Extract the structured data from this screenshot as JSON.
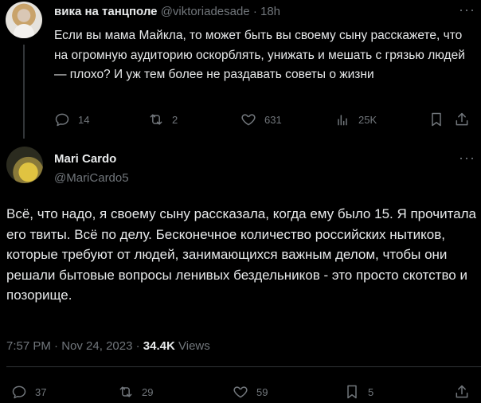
{
  "tweet1": {
    "author_name": "вика на танцполе",
    "author_handle": "@viktoriadesade",
    "separator": "·",
    "time_ago": "18h",
    "more_icon": "more-dots-icon",
    "text": "Если вы мама Майкла, то может быть вы своему сыну расскажете, что на огромную аудиторию оскорблять, унижать и мешать с грязью людей — плохо? И уж тем более не раздавать советы о жизни",
    "actions": {
      "replies": "14",
      "retweets": "2",
      "likes": "631",
      "views": "25K"
    }
  },
  "tweet2": {
    "author_name": "Mari Cardo",
    "author_handle": "@MariCardo5",
    "more_icon": "more-dots-icon",
    "text": "Всё, что надо, я своему сыну рассказала, когда ему было 15. Я прочитала его твиты. Всё по делу. Бесконечное количество российских нытиков, которые требуют от людей, занимающихся важным делом, чтобы они решали бытовые вопросы ленивых бездельников - это просто скотство и позорище.",
    "time": "7:57 PM",
    "dot": "·",
    "date": "Nov 24, 2023",
    "dot2": "·",
    "views_count": "34.4K",
    "views_label": "Views",
    "actions": {
      "replies": "37",
      "retweets": "29",
      "likes": "59",
      "bookmarks": "5"
    }
  },
  "colors": {
    "background": "#000000",
    "text": "#e7e9ea",
    "muted": "#71767b",
    "divider": "#2f3336"
  }
}
